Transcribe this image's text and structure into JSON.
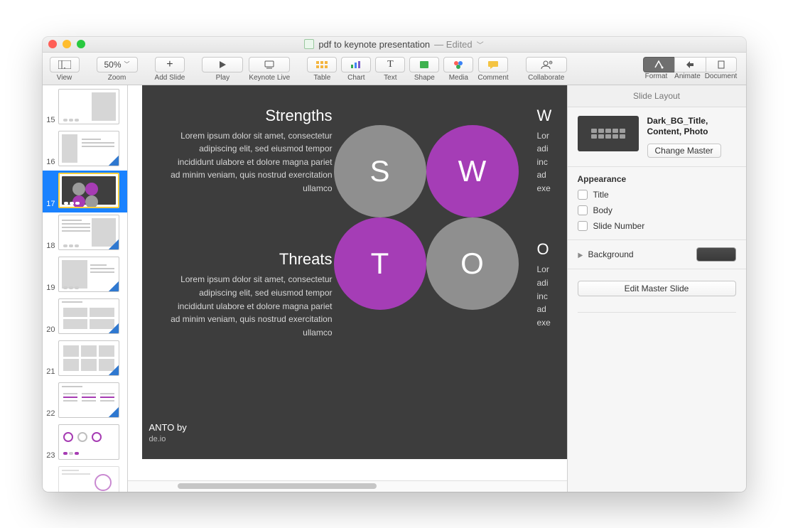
{
  "window": {
    "title": "pdf to keynote presentation",
    "state": "— Edited"
  },
  "toolbar": {
    "view": "View",
    "zoom_label": "Zoom",
    "zoom_value": "50%",
    "add_slide": "Add Slide",
    "play": "Play",
    "keynote_live": "Keynote Live",
    "table": "Table",
    "chart": "Chart",
    "text": "Text",
    "shape": "Shape",
    "media": "Media",
    "comment": "Comment",
    "collaborate": "Collaborate",
    "format": "Format",
    "animate": "Animate",
    "document": "Document"
  },
  "navigator": {
    "slides": [
      {
        "num": "15"
      },
      {
        "num": "16"
      },
      {
        "num": "17"
      },
      {
        "num": "18"
      },
      {
        "num": "19"
      },
      {
        "num": "20"
      },
      {
        "num": "21"
      },
      {
        "num": "22"
      },
      {
        "num": "23"
      }
    ],
    "selected_index": 2
  },
  "slide": {
    "strengths_title": "Strengths",
    "weaknesses_title": "W",
    "threats_title": "Threats",
    "opportunities_title": "O",
    "lorem": "Lorem ipsum dolor sit amet, consectetur adipiscing elit, sed eiusmod tempor incididunt ulabore et dolore magna pariet ad minim veniam, quis nostrud exercitation ullamco",
    "lorem_short": "Lor\nadi\ninc\nad\nexe",
    "swot": {
      "s": "S",
      "w": "W",
      "t": "T",
      "o": "O"
    },
    "footer_title": "ANTO by",
    "footer_sub": "de.io"
  },
  "inspector": {
    "header": "Slide Layout",
    "master_name_line1": "Dark_BG_Title,",
    "master_name_line2": "Content, Photo",
    "change_master": "Change Master",
    "appearance": "Appearance",
    "title_chk": "Title",
    "body_chk": "Body",
    "slidenum_chk": "Slide Number",
    "background": "Background",
    "background_color": "#3f3f3f",
    "edit_master": "Edit Master Slide"
  }
}
